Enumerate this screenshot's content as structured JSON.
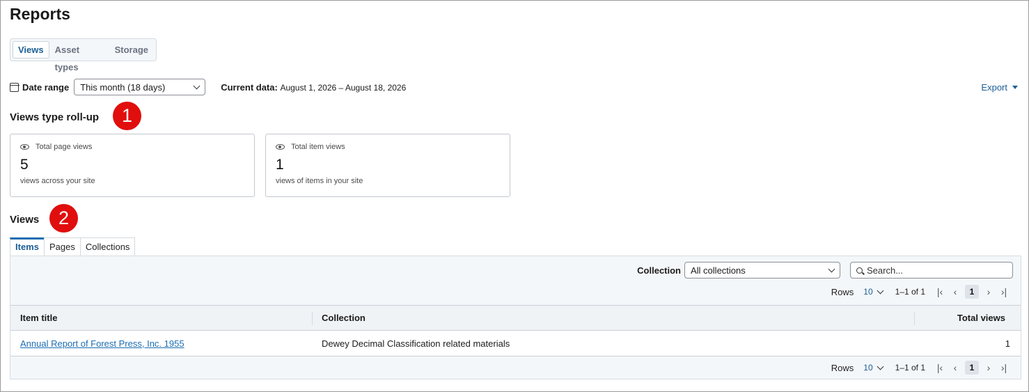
{
  "page": {
    "title": "Reports"
  },
  "segments": [
    {
      "label": "Views",
      "active": true
    },
    {
      "label": "Asset types",
      "active": false
    },
    {
      "label": "Storage",
      "active": false
    }
  ],
  "filters": {
    "date_range_label": "Date range",
    "date_range_value": "This month (18 days)",
    "current_data_label": "Current data:",
    "current_data_value": "August 1, 2026 – August 18, 2026",
    "export_label": "Export"
  },
  "rollup": {
    "heading": "Views type roll-up",
    "badge": "1",
    "cards": [
      {
        "label": "Total page views",
        "value": "5",
        "sub": "views across your site",
        "icon": "eye-icon"
      },
      {
        "label": "Total item views",
        "value": "1",
        "sub": "views of items in your site",
        "icon": "eye-icon"
      }
    ]
  },
  "views": {
    "heading": "Views",
    "badge": "2",
    "tabs": [
      {
        "label": "Items",
        "active": true
      },
      {
        "label": "Pages",
        "active": false
      },
      {
        "label": "Collections",
        "active": false
      }
    ],
    "collection_label": "Collection",
    "collection_value": "All collections",
    "search_placeholder": "Search...",
    "pager": {
      "rows_label": "Rows",
      "page_size": "10",
      "range": "1–1 of 1",
      "page": "1"
    },
    "columns": [
      "Item title",
      "Collection",
      "Total views"
    ],
    "rows": [
      {
        "title": "Annual Report of Forest Press, Inc. 1955",
        "collection": "Dewey Decimal Classification related materials",
        "views": "1"
      }
    ]
  },
  "colors": {
    "accent": "#1b5e96",
    "badge": "#e10e0e"
  }
}
